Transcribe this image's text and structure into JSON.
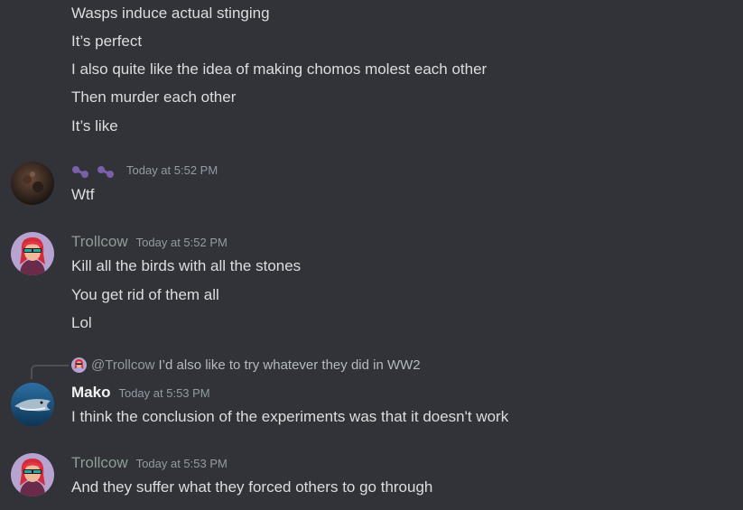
{
  "colors": {
    "background": "#313338",
    "text": "#dbdee1",
    "timestamp": "#949ba4",
    "trollcow_name": "#8f9c9a",
    "mako_name": "#f2f3f5",
    "emoji_purple": "#7b5fa8"
  },
  "continued_lines": [
    "Wasps induce actual stinging",
    "It’s perfect",
    "I also quite like the idea of making chomos molest each other",
    "Then murder each other",
    "It’s like"
  ],
  "messages": [
    {
      "username": "",
      "username_icons": [
        "purple-bead-icon",
        "purple-bead-icon"
      ],
      "timestamp": "Today at 5:52 PM",
      "lines": [
        "Wtf"
      ]
    },
    {
      "username": "Trollcow",
      "timestamp": "Today at 5:52 PM",
      "lines": [
        "Kill all the birds with all the stones",
        "You get rid of them all",
        "Lol"
      ]
    },
    {
      "reply": {
        "name": "@Trollcow",
        "text": "I’d also like to try whatever they did in WW2"
      },
      "username": "Mako",
      "timestamp": "Today at 5:53 PM",
      "lines": [
        "I think the conclusion of the experiments was that it doesn't work"
      ]
    },
    {
      "username": "Trollcow",
      "timestamp": "Today at 5:53 PM",
      "lines": [
        "And they suffer what they forced others to go through"
      ]
    }
  ]
}
